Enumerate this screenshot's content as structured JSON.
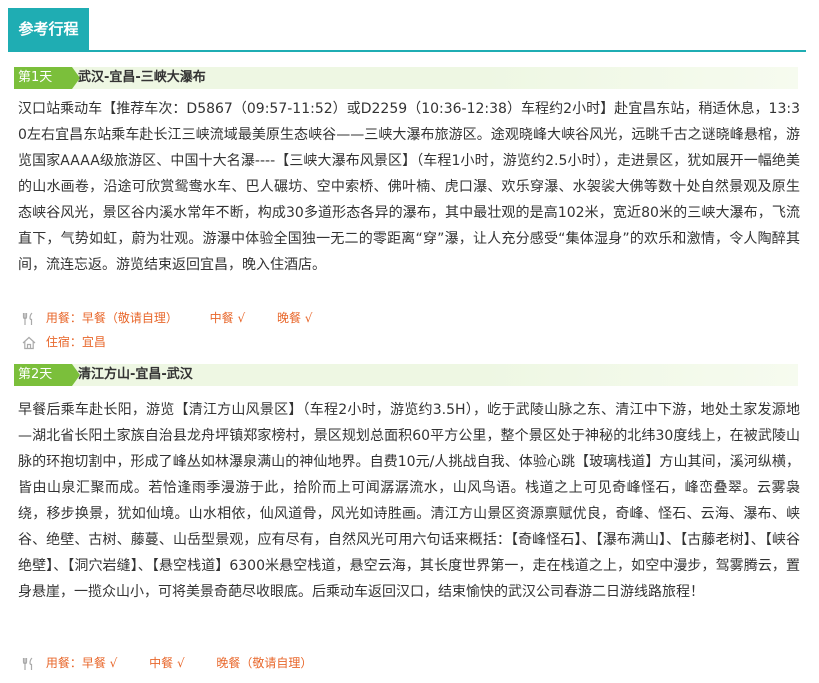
{
  "tab": {
    "label": "参考行程"
  },
  "days": [
    {
      "badge": "第1天",
      "route": "武汉-宜昌-三峡大瀑布",
      "description": "汉口站乘动车【推荐车次：D5867（09:57-11:52）或D2259（10:36-12:38）车程约2小时】赴宜昌东站，稍适休息，13:30左右宜昌东站乘车赴长江三峡流域最美原生态峡谷——三峡大瀑布旅游区。途观晓峰大峡谷风光，远眺千古之谜晓峰悬棺，游览国家AAAA级旅游区、中国十大名瀑----【三峡大瀑布风景区】（车程1小时，游览约2.5小时），走进景区，犹如展开一幅绝美的山水画卷，沿途可欣赏鸳鸯水车、巴人碾坊、空中索桥、佛叶楠、虎口瀑、欢乐穿瀑、水袈裟大佛等数十处自然景观及原生态峡谷风光，景区谷内溪水常年不断，构成30多道形态各异的瀑布，其中最壮观的是高102米，宽近80米的三峡大瀑布，飞流直下，气势如虹，蔚为壮观。游瀑中体验全国独一无二的零距离“穿”瀑，让人充分感受“集体湿身”的欢乐和激情，令人陶醉其间，流连忘返。游览结束返回宜昌，晚入住酒店。",
      "meals": {
        "breakfast": "用餐：早餐（敬请自理）",
        "lunch": "中餐 √",
        "dinner": "晚餐 √"
      },
      "lodging": "住宿：宜昌"
    },
    {
      "badge": "第2天",
      "route": "清江方山-宜昌-武汉",
      "description": "早餐后乘车赴长阳，游览【清江方山风景区】（车程2小时，游览约3.5H），屹于武陵山脉之东、清江中下游，地处土家发源地—湖北省长阳土家族自治县龙舟坪镇郑家榜村，景区规划总面积60平方公里，整个景区处于神秘的北纬30度线上，在被武陵山脉的环抱切割中，形成了峰丛如林瀑泉满山的神仙地界。自费10元/人挑战自我、体验心跳【玻璃栈道】方山其间，溪河纵横，皆由山泉汇聚而成。若恰逢雨季漫游于此，拾阶而上可闻潺潺流水，山风鸟语。栈道之上可见奇峰怪石，峰峦叠翠。云雾袅绕，移步换景，犹如仙境。山水相依，仙风道骨，风光如诗胜画。清江方山景区资源禀赋优良，奇峰、怪石、云海、瀑布、峡谷、绝壁、古树、藤蔓、山岳型景观，应有尽有，自然风光可用六句话来概括：【奇峰怪石】、【瀑布满山】、【古藤老树】、【峡谷绝壁】、【洞穴岩缝】、【悬空栈道】6300米悬空栈道，悬空云海，其长度世界第一，走在栈道之上，如空中漫步，驾雾腾云，置身悬崖，一揽众山小，可将美景奇葩尽收眼底。后乘动车返回汉口，结束愉快的武汉公司春游二日游线路旅程！",
      "meals": {
        "breakfast": "用餐：早餐 √",
        "lunch": "中餐 √",
        "dinner": "晚餐（敬请自理）"
      }
    }
  ],
  "colors": {
    "accent": "#1fadb3",
    "day_badge": "#7bbf3b",
    "day_header_bg": "#eef7e3",
    "meta_text": "#e8672b",
    "icon_gray": "#aaaaaa"
  },
  "icons": {
    "meal": "fork-knife-icon",
    "lodging": "house-icon"
  }
}
